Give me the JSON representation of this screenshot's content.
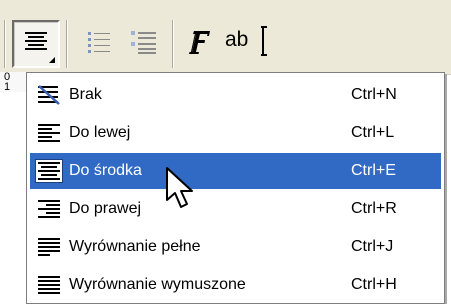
{
  "toolbar": {
    "buttons": [
      {
        "name": "alignment-dropdown-button",
        "icon": "align-center-icon",
        "pressed": true
      },
      {
        "name": "bullets-button",
        "icon": "bulleted-list-icon"
      },
      {
        "name": "numbering-button",
        "icon": "numbered-list-icon"
      },
      {
        "name": "font-button",
        "icon": "font-f-icon"
      }
    ],
    "text_field_sample": "ab"
  },
  "ruler": {
    "digits": [
      "0",
      "1"
    ]
  },
  "menu": {
    "items": [
      {
        "label": "Brak",
        "shortcut": "Ctrl+N",
        "icon": "align-none-icon",
        "highlighted": false
      },
      {
        "label": "Do lewej",
        "shortcut": "Ctrl+L",
        "icon": "align-left-icon",
        "highlighted": false
      },
      {
        "label": "Do środka",
        "shortcut": "Ctrl+E",
        "icon": "align-center-icon",
        "highlighted": true
      },
      {
        "label": "Do prawej",
        "shortcut": "Ctrl+R",
        "icon": "align-right-icon",
        "highlighted": false
      },
      {
        "label": "Wyrównanie pełne",
        "shortcut": "Ctrl+J",
        "icon": "align-justify-icon",
        "highlighted": false
      },
      {
        "label": "Wyrównanie wymuszone",
        "shortcut": "Ctrl+H",
        "icon": "align-force-justify-icon",
        "highlighted": false
      }
    ]
  },
  "colors": {
    "highlight": "#316ac5",
    "toolbar_bg": "#ece9d8"
  }
}
